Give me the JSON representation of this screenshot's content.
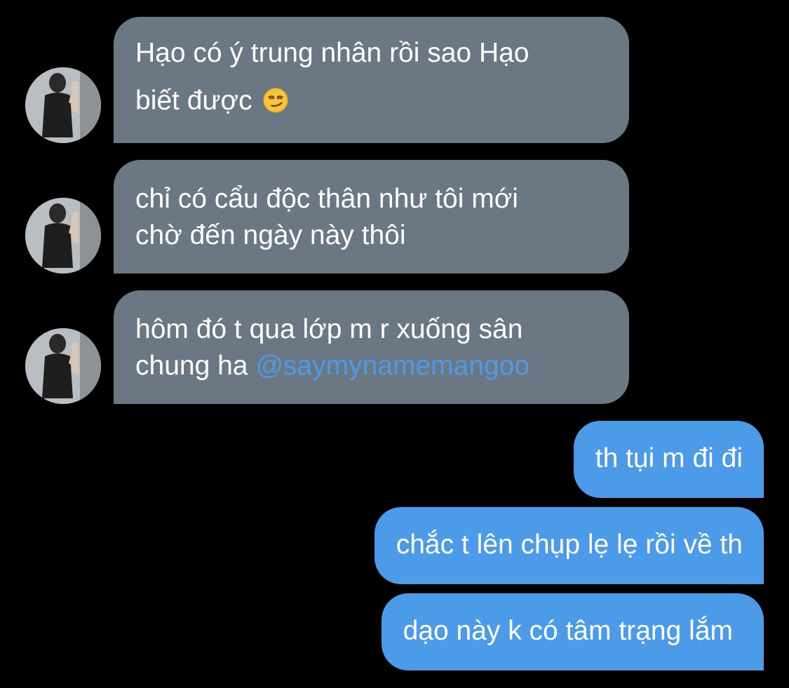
{
  "conversation": {
    "incoming": [
      {
        "lines": [
          "Hạo có ý trung nhân rồi sao Hạo",
          "biết được"
        ],
        "emoji": "smirking-face-emoji"
      },
      {
        "lines": [
          "chỉ có cẩu độc thân như tôi mới",
          "chờ đến ngày này thôi"
        ]
      },
      {
        "lines": [
          "hôm đó t qua lớp m r xuống sân",
          "chung ha"
        ],
        "mention": "@saymynamemangoo"
      }
    ],
    "outgoing": [
      {
        "text": "th tụi m đi đi"
      },
      {
        "text": "chắc t lên chụp lẹ lẹ rồi về th"
      },
      {
        "text": "dạo này k có tâm trạng lắm"
      }
    ]
  },
  "colors": {
    "background": "#000000",
    "incoming_bubble": "#6b7783",
    "outgoing_bubble": "#4c9be8",
    "mention": "#4c9be8",
    "text": "#ffffff"
  }
}
